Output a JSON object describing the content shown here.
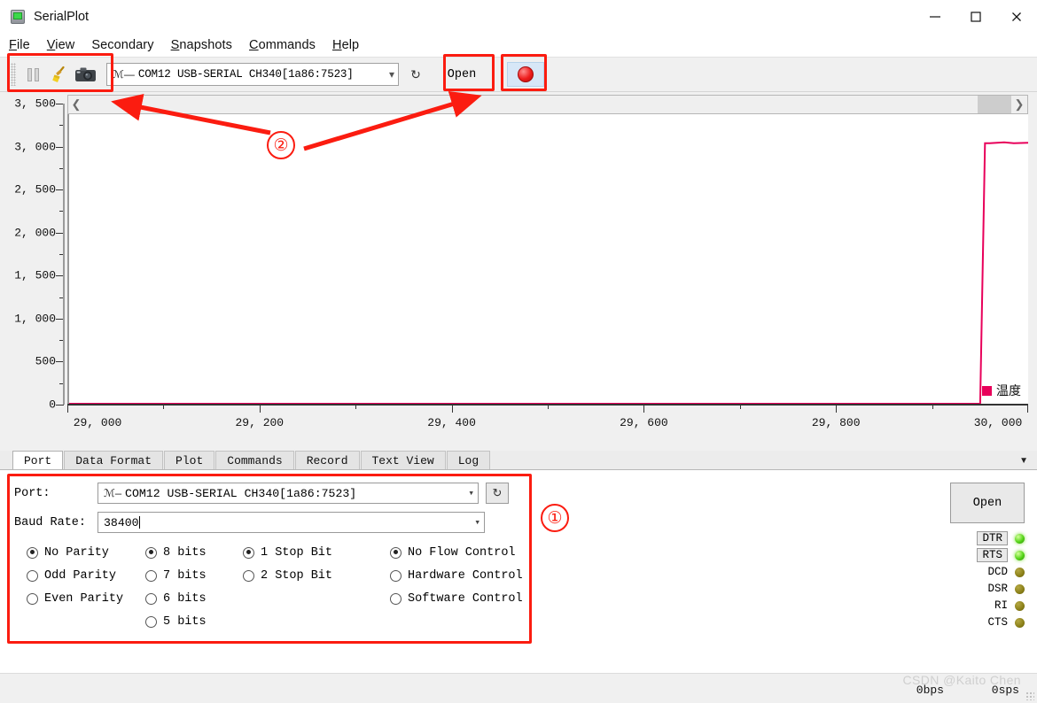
{
  "window": {
    "title": "SerialPlot",
    "app_icon": "serialplot-icon",
    "controls": {
      "minimize": "minimize-icon",
      "maximize": "maximize-icon",
      "close": "close-icon"
    }
  },
  "menubar": [
    {
      "label": "File",
      "accel": "F"
    },
    {
      "label": "View",
      "accel": "V"
    },
    {
      "label": "Secondary",
      "accel": ""
    },
    {
      "label": "Snapshots",
      "accel": "S"
    },
    {
      "label": "Commands",
      "accel": "C"
    },
    {
      "label": "Help",
      "accel": "H"
    }
  ],
  "toolbar": {
    "pause_icon": "pause-icon",
    "clear_icon": "broom-icon",
    "snapshot_icon": "camera-icon",
    "port_value": "COM12 USB-SERIAL CH340[1a86:7523]",
    "usb_icon": "usb-icon",
    "refresh_icon": "refresh-icon",
    "open_label": "Open",
    "record_icon": "record-icon"
  },
  "plot": {
    "scroll_left_icon": "chevron-left-icon",
    "scroll_right_icon": "chevron-right-icon",
    "legend_label": "温度",
    "legend_color": "#e8005a"
  },
  "chart_data": {
    "type": "line",
    "title": "",
    "xlabel": "",
    "ylabel": "",
    "xlim": [
      29000,
      30000
    ],
    "ylim": [
      0,
      3500
    ],
    "xticks": [
      "29, 000",
      "29, 200",
      "29, 400",
      "29, 600",
      "29, 800",
      "30, 000"
    ],
    "xtick_values": [
      29000,
      29200,
      29400,
      29600,
      29800,
      30000
    ],
    "yticks": [
      "0",
      "500",
      "1, 000",
      "1, 500",
      "2, 000",
      "2, 500",
      "3, 000",
      "3, 500"
    ],
    "ytick_values": [
      0,
      500,
      1000,
      1500,
      2000,
      2500,
      3000,
      3500
    ],
    "grid": false,
    "legend_position": "bottom-right",
    "series": [
      {
        "name": "温度",
        "color": "#e8005a",
        "x": [
          29000,
          29950,
          29955,
          29960,
          29975,
          29985,
          30000
        ],
        "y": [
          0,
          0,
          3150,
          3150,
          3160,
          3150,
          3155
        ]
      }
    ]
  },
  "tabs": [
    {
      "label": "Port",
      "active": true
    },
    {
      "label": "Data Format",
      "active": false
    },
    {
      "label": "Plot",
      "active": false
    },
    {
      "label": "Commands",
      "active": false
    },
    {
      "label": "Record",
      "active": false
    },
    {
      "label": "Text View",
      "active": false
    },
    {
      "label": "Log",
      "active": false
    }
  ],
  "tab_overflow_icon": "chevron-down-icon",
  "port_panel": {
    "port_label": "Port:",
    "port_value": "COM12 USB-SERIAL CH340[1a86:7523]",
    "baud_label": "Baud Rate:",
    "baud_value": "38400",
    "refresh_icon": "refresh-icon",
    "parity": [
      {
        "label": "No Parity",
        "selected": true
      },
      {
        "label": "Odd Parity",
        "selected": false
      },
      {
        "label": "Even Parity",
        "selected": false
      }
    ],
    "databits": [
      {
        "label": "8 bits",
        "selected": true
      },
      {
        "label": "7 bits",
        "selected": false
      },
      {
        "label": "6 bits",
        "selected": false
      },
      {
        "label": "5 bits",
        "selected": false
      }
    ],
    "stopbits": [
      {
        "label": "1 Stop Bit",
        "selected": true
      },
      {
        "label": "2 Stop Bit",
        "selected": false
      }
    ],
    "flow": [
      {
        "label": "No Flow Control",
        "selected": true
      },
      {
        "label": "Hardware Control",
        "selected": false
      },
      {
        "label": "Software Control",
        "selected": false
      }
    ],
    "open_label": "Open",
    "leds": [
      {
        "label": "DTR",
        "on": true,
        "button": true
      },
      {
        "label": "RTS",
        "on": true,
        "button": true
      },
      {
        "label": "DCD",
        "on": false,
        "button": false
      },
      {
        "label": "DSR",
        "on": false,
        "button": false
      },
      {
        "label": "RI",
        "on": false,
        "button": false
      },
      {
        "label": "CTS",
        "on": false,
        "button": false
      }
    ]
  },
  "statusbar": {
    "bps": "0bps",
    "sps": "0sps",
    "watermark": "CSDN @Kaito Chen"
  },
  "annotations": {
    "marker_one": "①",
    "marker_two": "②",
    "color": "#fb1c10"
  }
}
